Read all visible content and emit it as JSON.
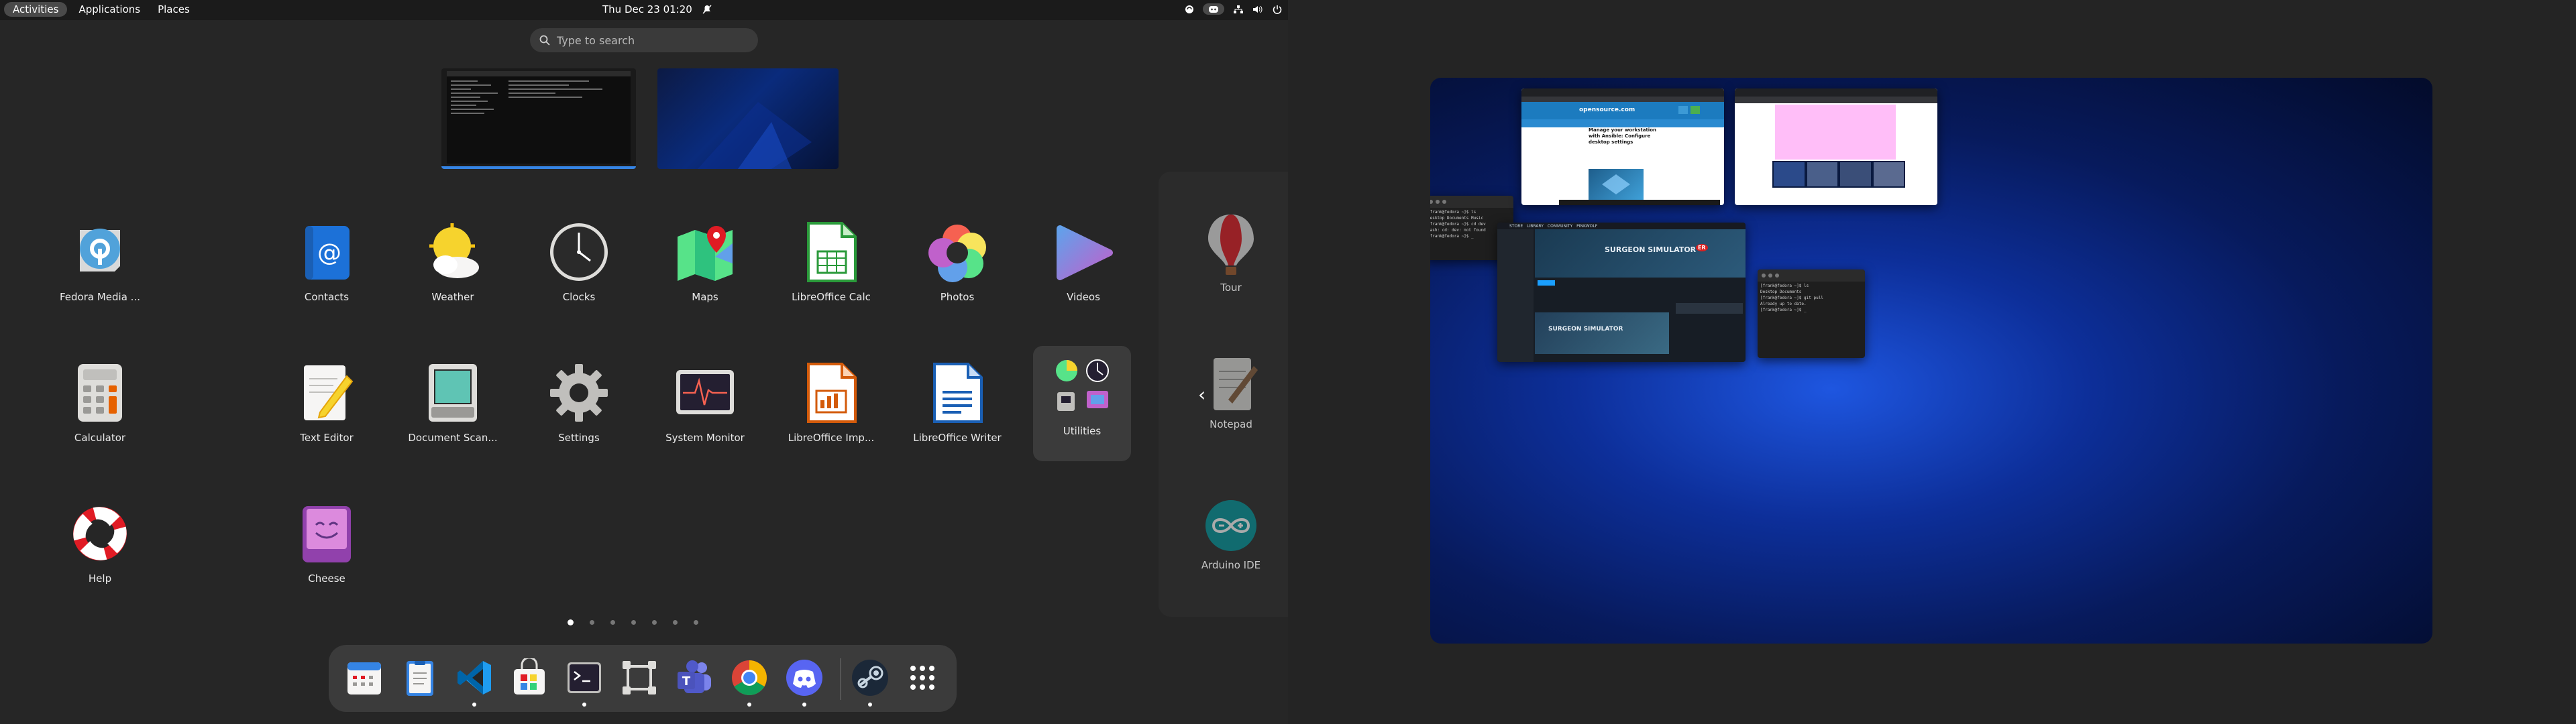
{
  "topbar": {
    "activities": "Activities",
    "applications": "Applications",
    "places": "Places",
    "clock": "Thu Dec 23  01:20"
  },
  "search": {
    "placeholder": "Type to search"
  },
  "apps": [
    {
      "label": "Fedora Media ...",
      "icon": "fedora-media-writer-icon"
    },
    {
      "label": "Contacts",
      "icon": "contacts-icon"
    },
    {
      "label": "Weather",
      "icon": "weather-icon"
    },
    {
      "label": "Clocks",
      "icon": "clocks-icon"
    },
    {
      "label": "Maps",
      "icon": "maps-icon"
    },
    {
      "label": "LibreOffice Calc",
      "icon": "libreoffice-calc-icon"
    },
    {
      "label": "Photos",
      "icon": "photos-icon"
    },
    {
      "label": "Videos",
      "icon": "videos-icon"
    },
    {
      "label": "Calculator",
      "icon": "calculator-icon"
    },
    {
      "label": "Text Editor",
      "icon": "text-editor-icon"
    },
    {
      "label": "Document Scan...",
      "icon": "document-scanner-icon"
    },
    {
      "label": "Settings",
      "icon": "settings-icon"
    },
    {
      "label": "System Monitor",
      "icon": "system-monitor-icon"
    },
    {
      "label": "LibreOffice Imp...",
      "icon": "libreoffice-impress-icon"
    },
    {
      "label": "LibreOffice Writer",
      "icon": "libreoffice-writer-icon"
    },
    {
      "label": "Utilities",
      "icon": "utilities-folder-icon"
    },
    {
      "label": "Help",
      "icon": "help-icon"
    },
    {
      "label": "Cheese",
      "icon": "cheese-icon"
    }
  ],
  "next_page_apps": [
    {
      "label": "Tour",
      "icon": "tour-icon"
    },
    {
      "label": "Notepad",
      "icon": "notepad-icon"
    },
    {
      "label": "Arduino IDE",
      "icon": "arduino-icon"
    }
  ],
  "pages": {
    "count": 7,
    "active": 1
  },
  "dock": [
    {
      "name": "calendar",
      "running": false
    },
    {
      "name": "files",
      "running": false
    },
    {
      "name": "vscode",
      "running": true
    },
    {
      "name": "software",
      "running": false
    },
    {
      "name": "terminal",
      "running": true
    },
    {
      "name": "kdenlive",
      "running": false
    },
    {
      "name": "teams",
      "running": false
    },
    {
      "name": "chrome",
      "running": true
    },
    {
      "name": "discord",
      "running": true
    },
    {
      "name": "steam",
      "running": true
    },
    {
      "name": "show-apps",
      "running": false
    }
  ],
  "windows": {
    "browser_site": "opensource.com",
    "article_title": "Manage your workstation with Ansible: Configure desktop settings",
    "game_title": "SURGEON SIMULATOR",
    "game_badge": "ER",
    "steam_tabs": [
      "STORE",
      "LIBRARY",
      "COMMUNITY",
      "PINKWOLF"
    ]
  },
  "colors": {
    "accent": "#3584e4",
    "panel": "#1b1b1b",
    "background": "#262626",
    "dock": "#3b3b3b"
  }
}
